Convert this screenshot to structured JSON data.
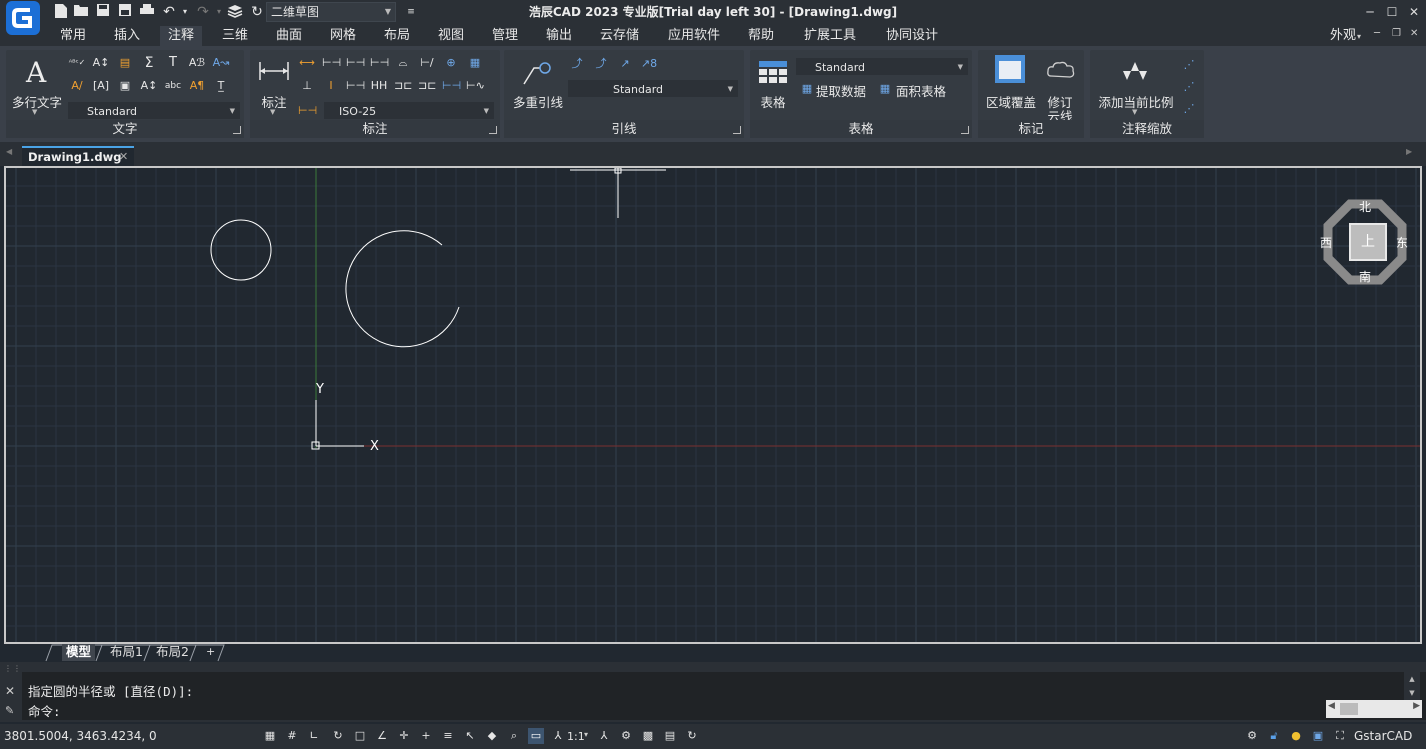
{
  "app": {
    "title": "浩辰CAD 2023 专业版[Trial day left 30] - [Drawing1.dwg]",
    "workspace": "二维草图",
    "appearance_menu": "外观"
  },
  "menu_tabs": [
    "常用",
    "插入",
    "注释",
    "三维",
    "曲面",
    "网格",
    "布局",
    "视图",
    "管理",
    "输出",
    "云存储",
    "应用软件",
    "帮助",
    "扩展工具",
    "协同设计"
  ],
  "ribbon": {
    "text_panel": {
      "title": "文字",
      "big_button": "多行文字",
      "style_combo": "Standard"
    },
    "dim_panel": {
      "title": "标注",
      "big_button": "标注",
      "style_combo": "ISO-25"
    },
    "leader_panel": {
      "title": "引线",
      "big_button": "多重引线",
      "style_combo": "Standard"
    },
    "table_panel": {
      "title": "表格",
      "big_button": "表格",
      "style_combo": "Standard",
      "extract": "提取数据",
      "area_table": "面积表格"
    },
    "mark_panel": {
      "title": "标记",
      "wipeout": "区域覆盖",
      "revcloud_line1": "修订",
      "revcloud_line2": "云线"
    },
    "scale_panel": {
      "title": "注释缩放",
      "add_scale": "添加当前比例"
    }
  },
  "document_tab": "Drawing1.dwg",
  "viewcube": {
    "top": "上",
    "north": "北",
    "south": "南",
    "east": "东",
    "west": "西"
  },
  "ucs": {
    "x_label": "X",
    "y_label": "Y"
  },
  "layout_tabs": [
    "模型",
    "布局1",
    "布局2",
    "+"
  ],
  "command": {
    "history_line": "指定圆的半径或 [直径(D)]:",
    "prompt": "命令:"
  },
  "status": {
    "coordinates": "3801.5004, 3463.4234, 0",
    "annotation_scale": "1:1",
    "brand": "GstarCAD"
  },
  "colors": {
    "canvas": "#212830",
    "grid": "#2b3542",
    "grid_major": "#33404e",
    "geometry": "#ffffff",
    "axis_y": "#3a7a3a",
    "axis_x": "#7a3030",
    "accent": "#4aa3e6"
  },
  "icons": [
    "app-logo-icon",
    "new-icon",
    "open-icon",
    "save-icon",
    "saveas-icon",
    "print-icon",
    "undo-icon",
    "redo-icon",
    "layers-icon",
    "refresh-icon"
  ]
}
